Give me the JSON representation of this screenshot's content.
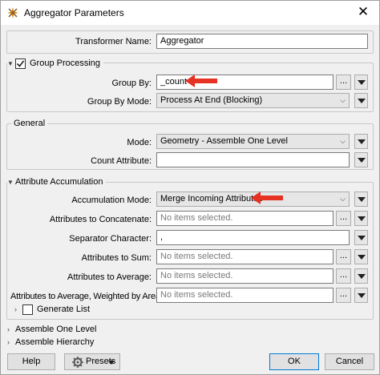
{
  "window": {
    "title": "Aggregator Parameters",
    "close_glyph": "✕"
  },
  "transformer": {
    "label": "Transformer Name:",
    "value": "Aggregator"
  },
  "group_processing": {
    "header": "Group Processing",
    "checked": true,
    "group_by_label": "Group By:",
    "group_by_value": "_count",
    "group_by_mode_label": "Group By Mode:",
    "group_by_mode_value": "Process At End (Blocking)"
  },
  "general": {
    "header": "General",
    "mode_label": "Mode:",
    "mode_value": "Geometry - Assemble One Level",
    "count_attr_label": "Count Attribute:",
    "count_attr_value": ""
  },
  "attribute_accumulation": {
    "header": "Attribute Accumulation",
    "accum_mode_label": "Accumulation Mode:",
    "accum_mode_value": "Merge Incoming Attributes",
    "concat_label": "Attributes to Concatenate:",
    "concat_placeholder": "No items selected.",
    "separator_label": "Separator Character:",
    "separator_value": ",",
    "sum_label": "Attributes to Sum:",
    "sum_placeholder": "No items selected.",
    "average_label": "Attributes to Average:",
    "average_placeholder": "No items selected.",
    "weighted_label": "Attributes to Average, Weighted by Area:",
    "weighted_placeholder": "No items selected.",
    "generate_list_label": "Generate List"
  },
  "sections": {
    "assemble_one_level": "Assemble One Level",
    "assemble_hierarchy": "Assemble Hierarchy"
  },
  "buttons": {
    "help": "Help",
    "presets": "Presets",
    "ok": "OK",
    "cancel": "Cancel",
    "ellipsis": "..."
  },
  "colors": {
    "highlight_arrow": "#e53222",
    "accent_border": "#0078d7"
  }
}
